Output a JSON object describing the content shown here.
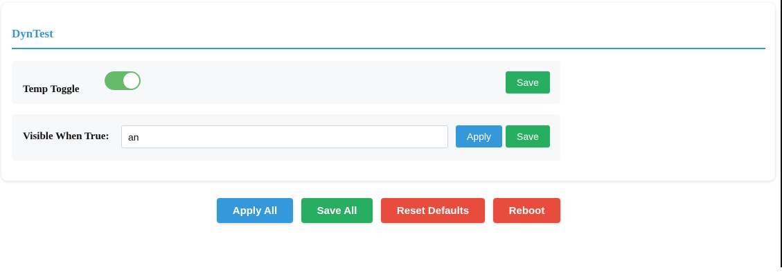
{
  "section": {
    "title": "DynTest"
  },
  "temp_toggle": {
    "label": "Temp Toggle",
    "state": "on",
    "save_label": "Save"
  },
  "visible_when_true": {
    "label": "Visible When True:",
    "value": "an",
    "apply_label": "Apply",
    "save_label": "Save"
  },
  "actions": {
    "apply_all": "Apply All",
    "save_all": "Save All",
    "reset_defaults": "Reset Defaults",
    "reboot": "Reboot"
  },
  "colors": {
    "accent": "#3a96d6",
    "green": "#27ae60",
    "toggle_on": "#66bb6a",
    "blue": "#3498db",
    "red": "#e74c3c"
  }
}
